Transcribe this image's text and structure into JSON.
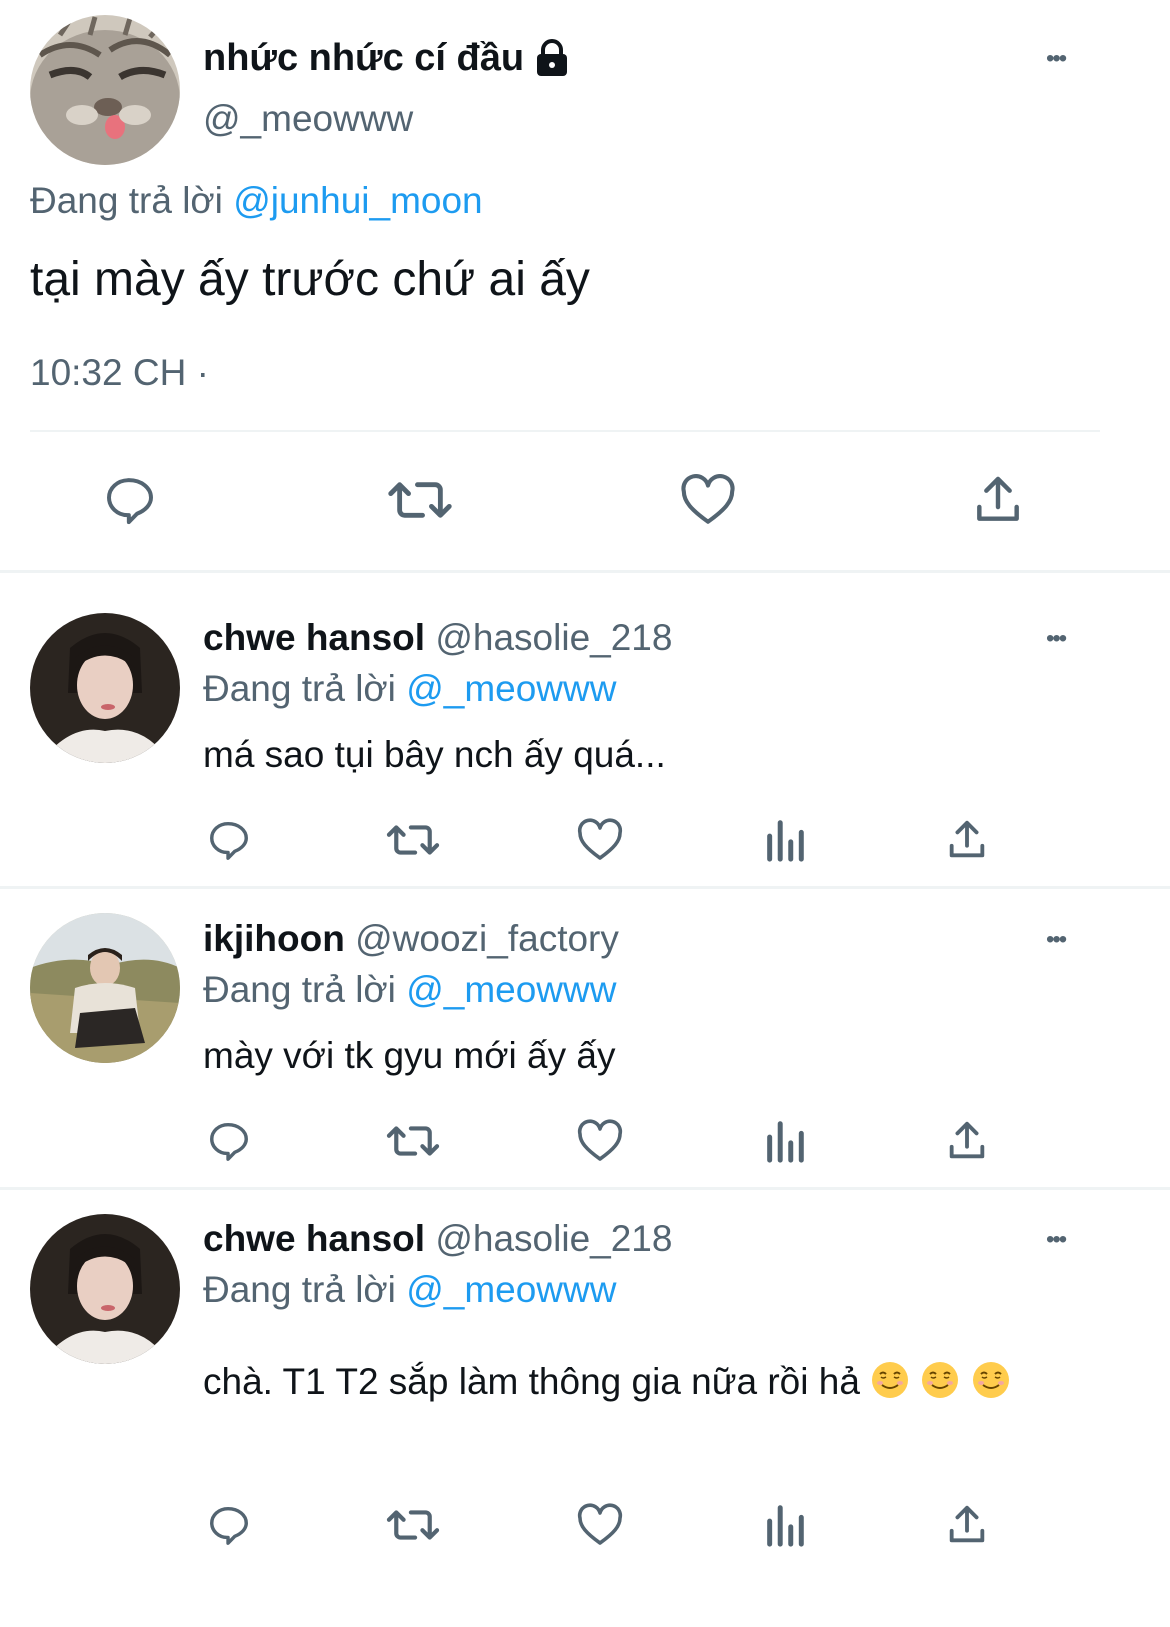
{
  "main_tweet": {
    "display_name": "nhức nhức cí đầu",
    "handle": "@_meowww",
    "reply_prefix": "Đang trả lời",
    "reply_to": "@junhui_moon",
    "text": "tại mày ấy trước chứ ai ấy",
    "time": "10:32 CH ·",
    "more": "•••",
    "avatar_icon": "cat-avatar",
    "locked_icon": "lock-icon"
  },
  "replies": [
    {
      "display_name": "chwe hansol",
      "handle": "@hasolie_218",
      "reply_prefix": "Đang trả lời",
      "reply_to": "@_meowww",
      "text": "má sao tụi bây nch ấy quá...",
      "more": "•••"
    },
    {
      "display_name": "ikjihoon",
      "handle": "@woozi_factory",
      "reply_prefix": "Đang trả lời",
      "reply_to": "@_meowww",
      "text": "mày với tk gyu mới ấy ấy",
      "more": "•••"
    },
    {
      "display_name": "chwe hansol",
      "handle": "@hasolie_218",
      "reply_prefix": "Đang trả lời",
      "reply_to": "@_meowww",
      "text": "chà. T1 T2 sắp làm thông gia nữa rồi hả",
      "emoji": "smiling-face-emoji",
      "more": "•••"
    }
  ],
  "colors": {
    "accent": "#1d9bf0",
    "secondary_text": "#536471",
    "divider": "#eff3f4"
  }
}
